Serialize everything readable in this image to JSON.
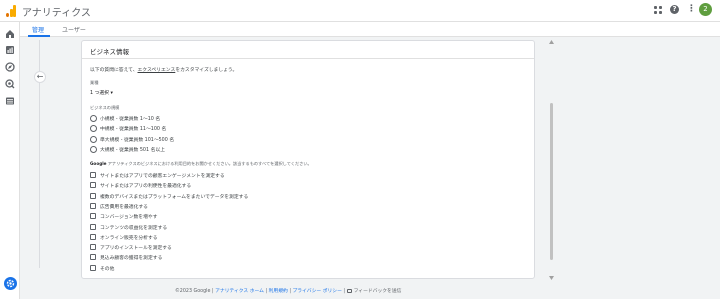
{
  "app": {
    "title": "アナリティクス",
    "avatar_letter": "2"
  },
  "colors": {
    "accent": "#1a73e8",
    "logo_orange": "#f9ab00",
    "logo_dark": "#e37400",
    "avatar": "#5f9e3f"
  },
  "tabs": [
    {
      "label": "管理"
    },
    {
      "label": "ユーザー"
    }
  ],
  "card": {
    "title": "ビジネス情報",
    "intro_before": "以下の質問に答えて、",
    "intro_link": "エクスペリエンス",
    "intro_after": "をカスタマイズしましょう。",
    "country_label": "業種",
    "country_value": "1 つ選択 ▾",
    "size_label": "ビジネスの規模",
    "size_options": [
      "小規模 - 従業員数 1～10 名",
      "中規模 - 従業員数 11～100 名",
      "準大規模 - 従業員数 101～500 名",
      "大規模 - 従業員数 501 名以上"
    ],
    "goal_brand": "Google",
    "goal_intro": " アナリティクスのビジネスにおける利用目的をお聞かせください。該当するものすべてを選択してください。",
    "goals": [
      "サイトまたはアプリでの顧客エンゲージメントを測定する",
      "サイトまたはアプリの利便性を最適化する",
      "複数のデバイスまたはプラットフォームをまたいでデータを測定する",
      "広告費用を最適化する",
      "コンバージョン数を増やす",
      "コンテンツの収益化を測定する",
      "オンライン販売を分析する",
      "アプリのインストールを測定する",
      "見込み顧客の獲得を測定する",
      "その他"
    ]
  },
  "footer": {
    "copyright": "©2023 Google | ",
    "home": "アナリティクス ホーム",
    "sep1": " | ",
    "terms": "利用規約",
    "sep2": " | ",
    "privacy": "プライバシー ポリシー",
    "sep3": " | ",
    "feedback": "フィードバックを送信"
  }
}
